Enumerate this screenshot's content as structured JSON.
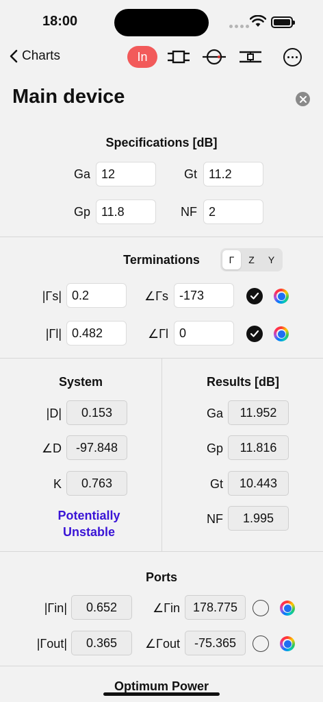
{
  "status": {
    "time": "18:00"
  },
  "nav": {
    "back_label": "Charts",
    "segment_selected": "In",
    "icons": [
      "two-port-block-icon",
      "circle-line-icon",
      "tuner-block-icon"
    ]
  },
  "page_title": "Main device",
  "specifications": {
    "title": "Specifications [dB]",
    "fields": [
      {
        "label": "Ga",
        "value": "12"
      },
      {
        "label": "Gt",
        "value": "11.2"
      },
      {
        "label": "Gp",
        "value": "11.8"
      },
      {
        "label": "NF",
        "value": "2"
      }
    ]
  },
  "terminations": {
    "title": "Terminations",
    "segments": [
      "Γ",
      "Z",
      "Y"
    ],
    "selected_segment": "Γ",
    "rows": [
      {
        "mag_label": "|Γs|",
        "mag_value": "0.2",
        "ang_label": "∠Γs",
        "ang_value": "-173"
      },
      {
        "mag_label": "|Γl|",
        "mag_value": "0.482",
        "ang_label": "∠Γl",
        "ang_value": "0"
      }
    ]
  },
  "system": {
    "title": "System",
    "rows": [
      {
        "label": "|D|",
        "value": "0.153"
      },
      {
        "label": "∠D",
        "value": "-97.848"
      },
      {
        "label": "K",
        "value": "0.763"
      }
    ],
    "stability_line1": "Potentially",
    "stability_line2": "Unstable",
    "stability_color": "#3a14d6"
  },
  "results": {
    "title": "Results [dB]",
    "rows": [
      {
        "label": "Ga",
        "value": "11.952"
      },
      {
        "label": "Gp",
        "value": "11.816"
      },
      {
        "label": "Gt",
        "value": "10.443"
      },
      {
        "label": "NF",
        "value": "1.995"
      }
    ]
  },
  "ports": {
    "title": "Ports",
    "rows": [
      {
        "mag_label": "|Γin|",
        "mag_value": "0.652",
        "ang_label": "∠Γin",
        "ang_value": "178.775"
      },
      {
        "mag_label": "|Γout|",
        "mag_value": "0.365",
        "ang_label": "∠Γout",
        "ang_value": "-75.365"
      }
    ]
  },
  "next_section_title": "Optimum Power",
  "colors": {
    "accent_red": "#f25a5a",
    "well_blue": "#1e6ff2"
  }
}
